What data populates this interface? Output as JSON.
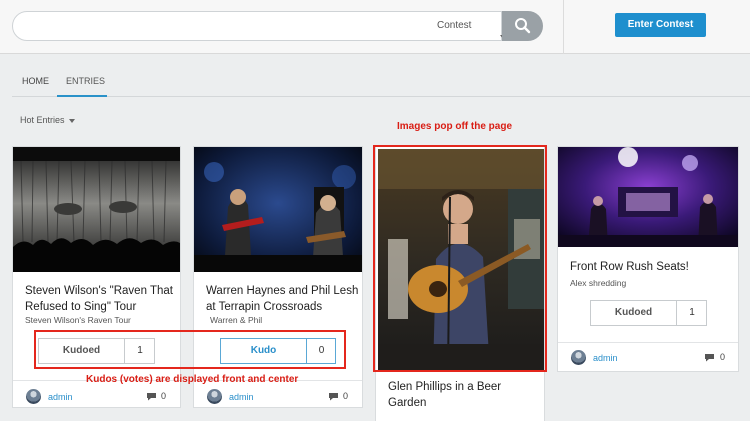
{
  "header": {
    "search": {
      "placeholder": "",
      "contest_select": "Contest"
    },
    "enter_button": "Enter Contest"
  },
  "tabs": [
    {
      "label": "HOME",
      "active": false
    },
    {
      "label": "ENTRIES",
      "active": true
    }
  ],
  "sort": {
    "label": "Hot Entries"
  },
  "annotations": {
    "images": "Images pop off the page",
    "kudos": "Kudos (votes) are displayed front and center"
  },
  "cards": [
    {
      "title": "Steven Wilson's \"Raven That Refused to Sing\" Tour",
      "subtitle": "Steven Wilson's Raven Tour",
      "kudo_label": "Kudoed",
      "kudo_count": "1",
      "author": "admin",
      "comments": "0"
    },
    {
      "title": "Warren Haynes and Phil Lesh at Terrapin Crossroads",
      "subtitle": "Warren & Phil",
      "kudo_label": "Kudo",
      "kudo_count": "0",
      "author": "admin",
      "comments": "0"
    },
    {
      "title": "Glen Phillips in a Beer Garden"
    },
    {
      "title": "Front Row Rush Seats!",
      "subtitle": "Alex shredding",
      "kudo_label": "Kudoed",
      "kudo_count": "1",
      "author": "admin",
      "comments": "0"
    }
  ],
  "colors": {
    "accent": "#1e8fce",
    "annotation_red": "#e4271d",
    "search_button": "#9aa1a6"
  },
  "icons": [
    "search-icon",
    "chevron-down-icon",
    "comment-icon",
    "avatar"
  ]
}
